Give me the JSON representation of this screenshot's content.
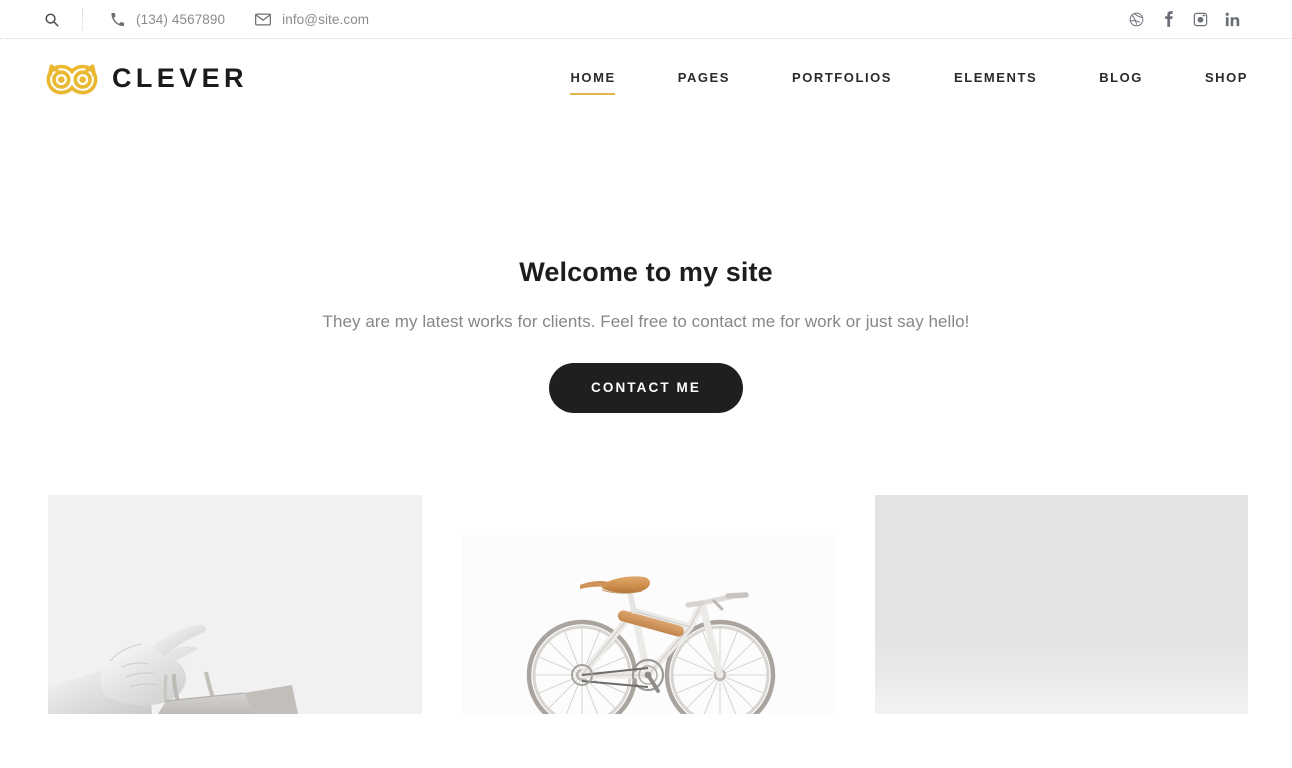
{
  "topbar": {
    "search_icon": "search-icon",
    "contacts": [
      {
        "icon": "phone-icon",
        "text": "(134) 4567890"
      },
      {
        "icon": "envelope-icon",
        "text": "info@site.com"
      }
    ],
    "social": [
      {
        "name": "dribbble-icon",
        "label": "Dribbble"
      },
      {
        "name": "facebook-icon",
        "label": "Facebook"
      },
      {
        "name": "instagram-icon",
        "label": "Instagram"
      },
      {
        "name": "linkedin-icon",
        "label": "LinkedIn"
      }
    ]
  },
  "header": {
    "logo_text": "CLEVER",
    "logo_icon": "owl-logo-icon",
    "logo_color": "#E8B931",
    "nav": [
      {
        "label": "HOME",
        "active": true
      },
      {
        "label": "PAGES",
        "active": false
      },
      {
        "label": "PORTFOLIOS",
        "active": false
      },
      {
        "label": "ELEMENTS",
        "active": false
      },
      {
        "label": "BLOG",
        "active": false
      },
      {
        "label": "SHOP",
        "active": false
      }
    ],
    "active_underline_color": "#E0B64A"
  },
  "hero": {
    "title": "Welcome to my site",
    "subtitle": "They are my latest works for clients. Feel free to contact me for work or just say hello!",
    "button_label": "CONTACT ME",
    "button_bg": "#1F1F1F",
    "button_text_color": "#FFFFFF"
  },
  "portfolio": {
    "items": [
      {
        "name": "hand-holding-shopping-bag",
        "bg": "#F1F1F1"
      },
      {
        "name": "white-bicycle-with-tan-saddle",
        "bg": "#FCFCFC"
      },
      {
        "name": "plain-gray-backdrop",
        "bg": "#E3E3E3"
      }
    ]
  }
}
